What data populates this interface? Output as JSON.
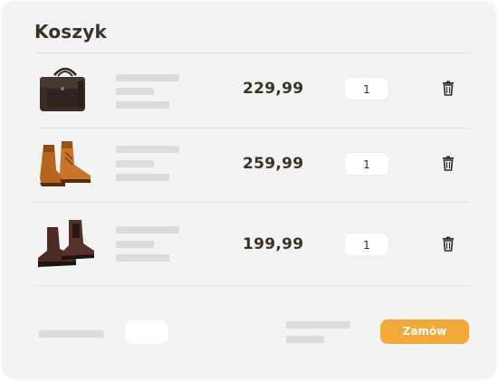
{
  "cart": {
    "title": "Koszyk",
    "items": [
      {
        "image": "briefcase-image",
        "price": "229,99",
        "quantity": "1"
      },
      {
        "image": "boots-image",
        "price": "259,99",
        "quantity": "1"
      },
      {
        "image": "chelsea-boots-image",
        "price": "199,99",
        "quantity": "1"
      }
    ],
    "delete_icon": "trash-icon",
    "order_button": "Zamów"
  },
  "colors": {
    "panel": "#f3f3f3",
    "text_dark": "#3b3226",
    "accent": "#f3a93a",
    "skeleton": "#dcdcdc"
  }
}
